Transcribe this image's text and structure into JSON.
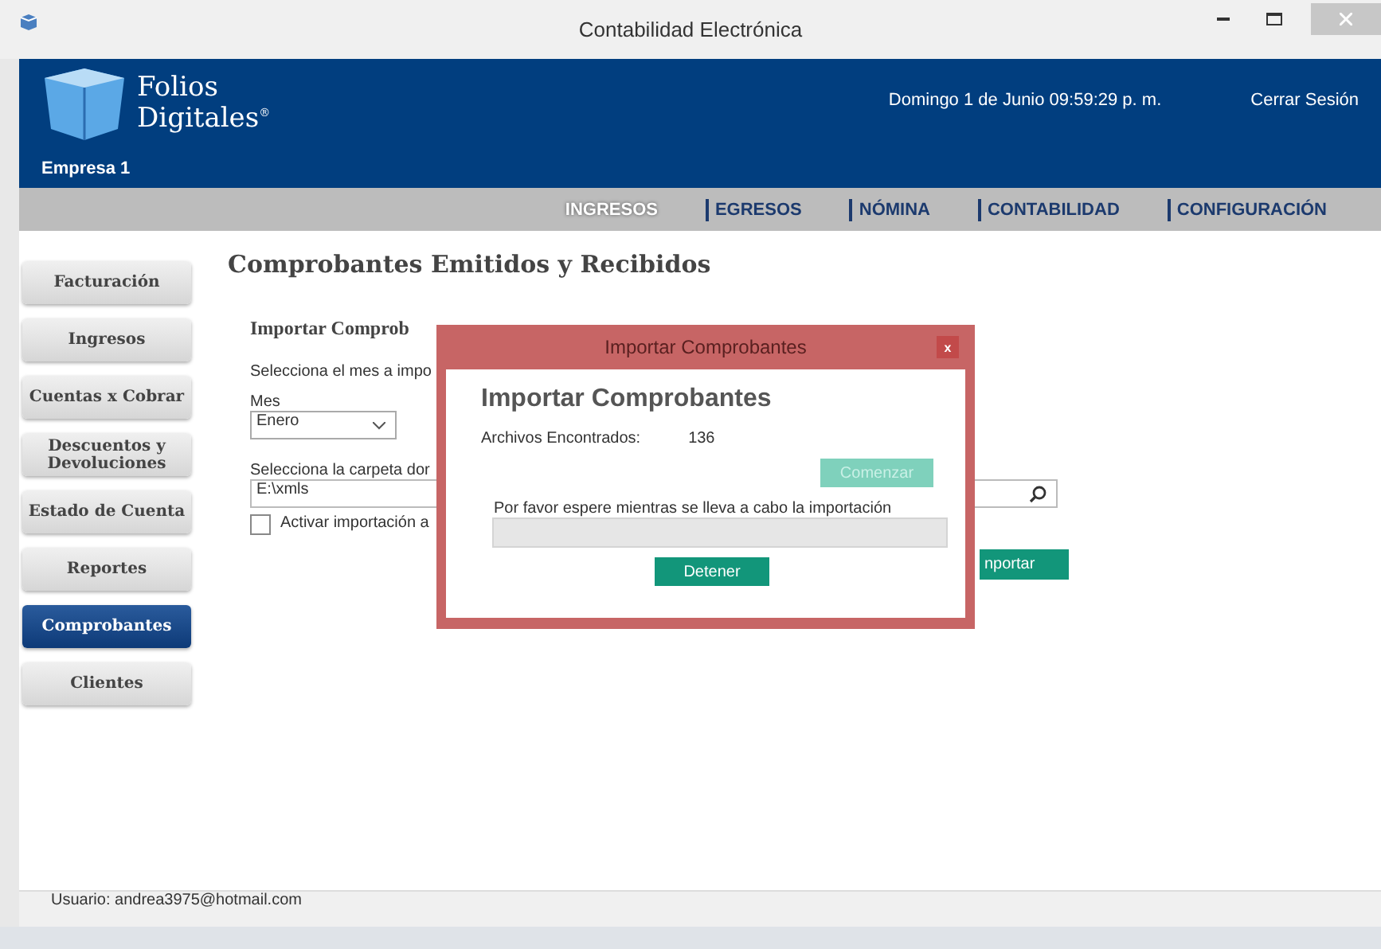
{
  "window": {
    "title": "Contabilidad Electrónica"
  },
  "header": {
    "logo_line_1": "Folios",
    "logo_line_2": "Digitales",
    "registered": "®",
    "company": "Empresa 1",
    "datetime": "Domingo 1 de Junio 09:59:29 p. m.",
    "logout": "Cerrar Sesión"
  },
  "nav": [
    {
      "label": "INGRESOS",
      "selected": true
    },
    {
      "label": "EGRESOS",
      "selected": false
    },
    {
      "label": "NÓMINA",
      "selected": false
    },
    {
      "label": "CONTABILIDAD",
      "selected": false
    },
    {
      "label": "CONFIGURACIÓN",
      "selected": false
    }
  ],
  "sidebar": [
    {
      "label": "Facturación",
      "selected": false
    },
    {
      "label": "Ingresos",
      "selected": false
    },
    {
      "label": "Cuentas x Cobrar",
      "selected": false
    },
    {
      "label": "Descuentos y Devoluciones",
      "selected": false
    },
    {
      "label": "Estado de Cuenta",
      "selected": false
    },
    {
      "label": "Reportes",
      "selected": false
    },
    {
      "label": "Comprobantes",
      "selected": true
    },
    {
      "label": "Clientes",
      "selected": false
    }
  ],
  "content": {
    "title": "Comprobantes Emitidos y Recibidos",
    "section": "Importar Comprob",
    "month_prompt": "Selecciona el mes a impo",
    "month_label": "Mes",
    "month_value": "Enero",
    "folder_prompt": "Selecciona la carpeta dor",
    "folder_value": "E:\\xmls",
    "auto_import": {
      "label": "Activar importación a",
      "checked": false
    },
    "import_button": "nportar"
  },
  "dialog": {
    "title": "Importar Comprobantes",
    "close": "x",
    "heading": "Importar Comprobantes",
    "files_label": "Archivos Encontrados:",
    "files_count": "136",
    "start_button": {
      "label": "Comenzar",
      "disabled": true
    },
    "message": "Por favor espere mientras se lleva a cabo la importación",
    "progress": {
      "level": 0
    },
    "stop_button": "Detener"
  },
  "status_bar": {
    "user": "Usuario: andrea3975@hotmail.com"
  }
}
